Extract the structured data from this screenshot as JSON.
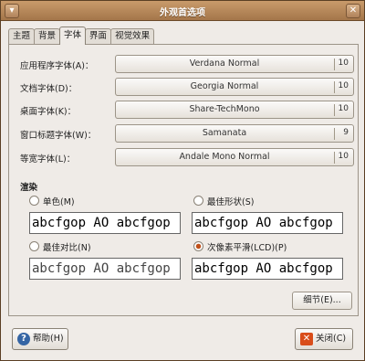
{
  "window": {
    "title": "外观首选项"
  },
  "tabs": [
    "主题",
    "背景",
    "字体",
    "界面",
    "视觉效果"
  ],
  "active_tab_index": 2,
  "font_rows": [
    {
      "label": "应用程序字体(A)：",
      "font": "Verdana Normal",
      "size": "10"
    },
    {
      "label": "文档字体(D)：",
      "font": "Georgia Normal",
      "size": "10"
    },
    {
      "label": "桌面字体(K)：",
      "font": "Share-TechMono",
      "size": "10"
    },
    {
      "label": "窗口标题字体(W)：",
      "font": "Samanata",
      "size": "9"
    },
    {
      "label": "等宽字体(L)：",
      "font": "Andale Mono Normal",
      "size": "10"
    }
  ],
  "rendering": {
    "title": "渲染",
    "sample_text": "abcfgop AO abcfgop",
    "options": [
      {
        "label": "单色(M)",
        "checked": false
      },
      {
        "label": "最佳形状(S)",
        "checked": false
      },
      {
        "label": "最佳对比(N)",
        "checked": false
      },
      {
        "label": "次像素平滑(LCD)(P)",
        "checked": true
      }
    ],
    "details_label": "细节(E)..."
  },
  "buttons": {
    "help_label": "帮助(H)",
    "close_label": "关闭(C)"
  },
  "colors": {
    "titlebar": "#b38557",
    "accent": "#c0501a"
  }
}
